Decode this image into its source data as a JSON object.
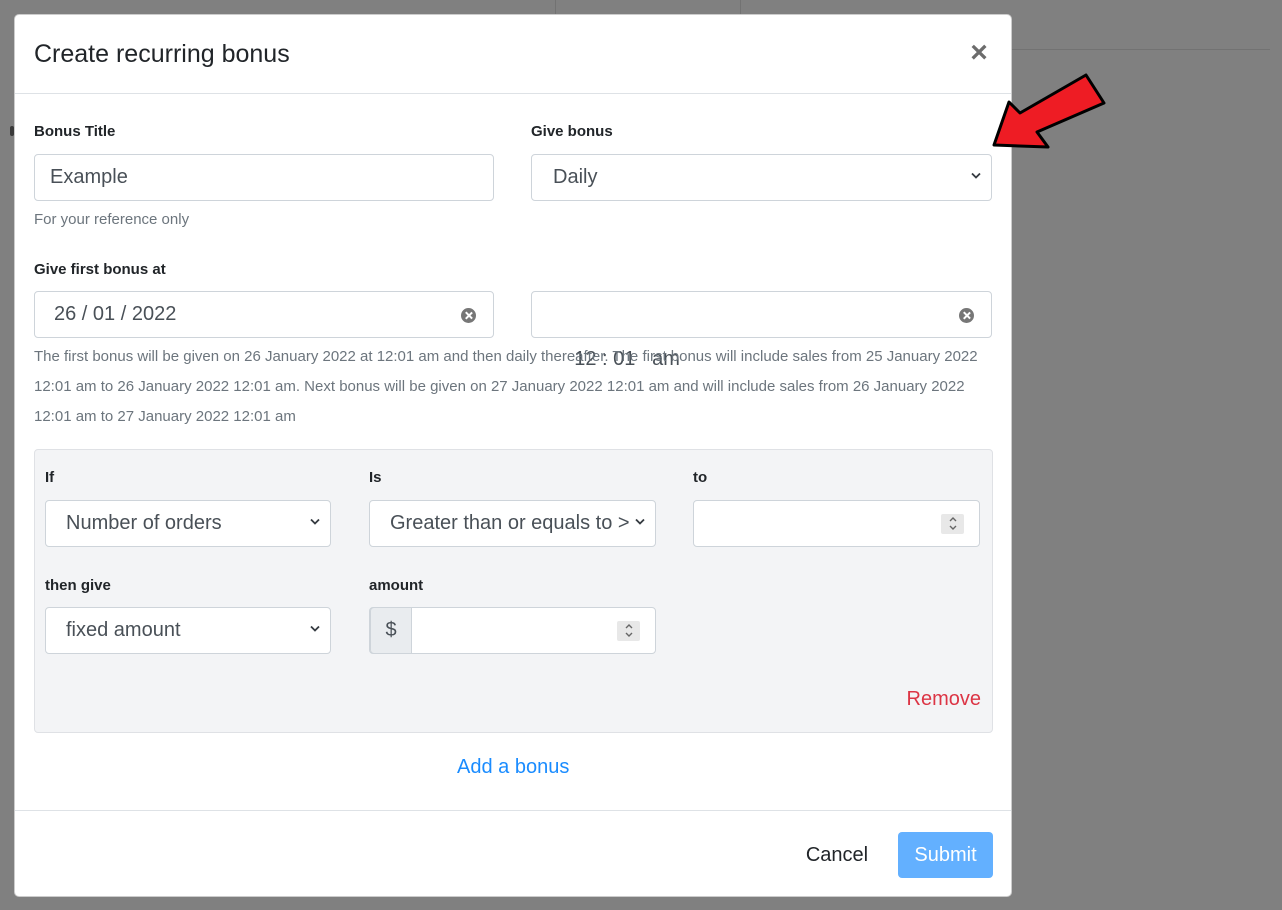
{
  "modal": {
    "title": "Create recurring bonus",
    "close_glyph": "×"
  },
  "form": {
    "bonus_title_label": "Bonus Title",
    "bonus_title_value": "Example",
    "bonus_title_helper": "For your reference only",
    "give_bonus_label": "Give bonus",
    "give_bonus_value": "Daily",
    "first_bonus_label": "Give first bonus at",
    "date_value": "26 / 01 / 2022",
    "time_value": "12 : 01   am",
    "description": "The first bonus will be given on 26 January 2022 at 12:01 am and then daily thereafter. The first bonus will include sales from 25 January 2022 12:01 am to 26 January 2022 12:01 am. Next bonus will be given on 27 January 2022 12:01 am and will include sales from 26 January 2022 12:01 am to 27 January 2022 12:01 am"
  },
  "bonus_rule": {
    "if_label": "If",
    "if_value": "Number of orders",
    "is_label": "Is",
    "is_value": "Greater than or equals to >",
    "to_label": "to",
    "to_value": "",
    "then_give_label": "then give",
    "then_give_value": "fixed amount",
    "amount_label": "amount",
    "amount_prefix": "$",
    "amount_value": "",
    "remove_label": "Remove"
  },
  "add_bonus_label": "Add a bonus",
  "footer": {
    "cancel_label": "Cancel",
    "submit_label": "Submit"
  },
  "colors": {
    "backdrop": "#808080",
    "accent": "#1a8cff",
    "danger": "#dc3545",
    "submit_bg": "#63b0ff",
    "arrow": "#ee1c24"
  },
  "icons": {
    "close": "close-icon",
    "select_arrow": "chevron-down-icon",
    "clear": "clear-icon",
    "spinner": "spinner-arrows-icon",
    "annotation": "red-arrow-icon"
  }
}
